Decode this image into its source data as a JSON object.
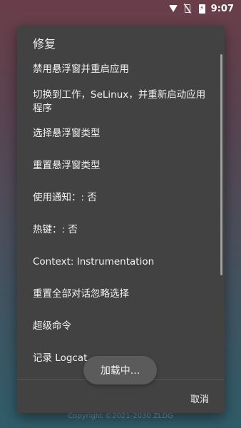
{
  "status_bar": {
    "time": "9:07",
    "icons": [
      "wifi-icon",
      "no-sim-icon",
      "battery-charging-icon"
    ]
  },
  "dialog": {
    "title": "修复",
    "items": [
      "禁用悬浮窗并重启应用",
      "切换到工作，SeLinux，并重新启动应用程序",
      "选择悬浮窗类型",
      "重置悬浮窗类型",
      "使用通知：: 否",
      "热键：: 否",
      "Context: Instrumentation",
      "重置全部对话忽略选择",
      "超级命令",
      "记录 Logcat"
    ],
    "cancel_label": "取消"
  },
  "toast": {
    "text": "加载中..."
  },
  "footer": {
    "text": "Copyright ©2021-2030 ZLDG"
  }
}
